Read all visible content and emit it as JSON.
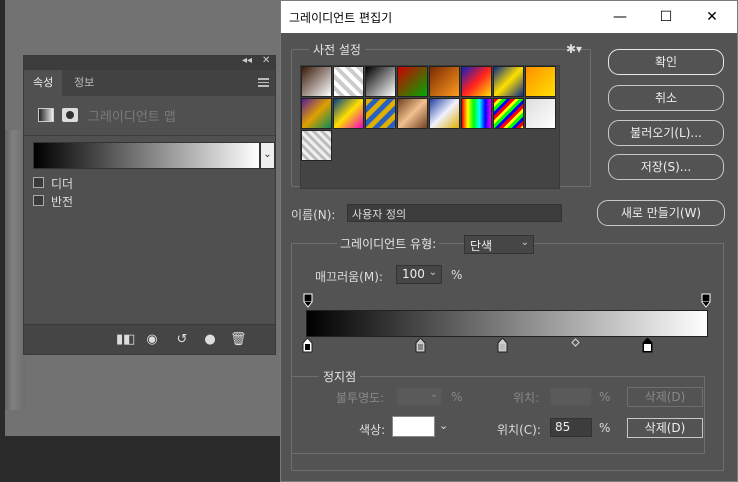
{
  "properties_panel": {
    "tabs": [
      "속성",
      "정보"
    ],
    "collapse_glyph": "◂◂",
    "close_glyph": "✕",
    "header_title": "그레이디언트 맵",
    "options": [
      {
        "label": "디더",
        "checked": false
      },
      {
        "label": "반전",
        "checked": false
      }
    ],
    "bottom_icons": [
      "clip-to-layer-icon",
      "view-previous-icon",
      "reset-icon",
      "visibility-icon",
      "delete-icon"
    ]
  },
  "dialog": {
    "title": "그레이디언트 편집기",
    "controls": {
      "minimize": "—",
      "maximize": "☐",
      "close": "✕"
    },
    "presets": {
      "legend": "사전 설정",
      "gear": "✱▾",
      "swatches": [
        "linear-gradient(135deg,#3a1a0a,#fff)",
        "repeating-linear-gradient(45deg,#fff 0 4px,#ccc 4px 8px)",
        "linear-gradient(135deg,#000,#fff)",
        "linear-gradient(135deg,#c00,#0a0)",
        "linear-gradient(135deg,#7a2a00,#ff9a20)",
        "linear-gradient(135deg,#1020c0,#ff2020,#ffe000)",
        "linear-gradient(135deg,#0a2a8a,#ffe000,#0a2a8a)",
        "linear-gradient(135deg,#ff9000,#ffe000)",
        "linear-gradient(135deg,#5a1a9a,#e0a000,#0a8a5a)",
        "linear-gradient(135deg,#00408a,#ffe000,#f000c0)",
        "repeating-linear-gradient(135deg,#e0b000 0 5px,#2a60c0 5px 10px)",
        "linear-gradient(135deg,#704020,#f0c090,#704020)",
        "linear-gradient(135deg,#2040a0,#f0f0ff,#e0b000)",
        "linear-gradient(90deg,#f00,#ff0,#0f0,#0ff,#00f,#f0f)",
        "repeating-linear-gradient(135deg,#f00 0 3px,#ff0 3px 6px,#0f0 6px 9px,#00f 9px 12px)",
        "linear-gradient(135deg,#ddd,#fff)",
        "repeating-linear-gradient(45deg,#eee 0 3px,#bbb 3px 6px)"
      ]
    },
    "buttons": {
      "ok": "확인",
      "cancel": "취소",
      "load": "불러오기(L)...",
      "save": "저장(S)...",
      "new": "새로 만들기(W)"
    },
    "name_label": "이름(N):",
    "name_value": "사용자 정의",
    "gradient_type_label": "그레이디언트 유형:",
    "gradient_type_value": "단색",
    "smoothness_label": "매끄러움(M):",
    "smoothness_value": "100",
    "smoothness_unit": "%",
    "stops": {
      "legend": "정지점",
      "opacity_label": "불투명도:",
      "opacity_unit": "%",
      "opacity_location_label": "위치:",
      "opacity_location_unit": "%",
      "opacity_delete": "삭제(D)",
      "color_label": "색상:",
      "color_value": "#ffffff",
      "color_location_label": "위치(C):",
      "color_location_value": "85",
      "color_location_unit": "%",
      "color_delete": "삭제(D)"
    }
  }
}
